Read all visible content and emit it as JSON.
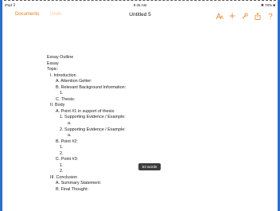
{
  "status_bar": {
    "carrier": "iPad ⊽",
    "time": "9:46 AM",
    "battery": "✱ 78% ■"
  },
  "toolbar": {
    "documents_label": "Documents",
    "undo_label": "Undo",
    "title": "Untitled 5",
    "accent_color": "#e8791c",
    "icons": [
      "text-format-icon",
      "add-icon",
      "wrench-icon",
      "share-icon",
      "help-icon"
    ]
  },
  "document": {
    "lines": [
      {
        "indent": 0,
        "text": "Essay Outline"
      },
      {
        "indent": 0,
        "text": "Essay"
      },
      {
        "indent": 0,
        "text": "Topic:"
      },
      {
        "indent": 1,
        "text": "I. Introduction"
      },
      {
        "indent": 2,
        "text": "A. Attention Getter:"
      },
      {
        "indent": 2,
        "text": "B. Relevant Background Information:"
      },
      {
        "indent": 3,
        "text": "1."
      },
      {
        "indent": 2,
        "text": "C. Thesis:"
      },
      {
        "indent": 1,
        "text": "II. Body"
      },
      {
        "indent": 2,
        "text": "A. Point #1 in support of thesis:"
      },
      {
        "indent": 3,
        "text": "1. Supporting Evidence / Example:"
      },
      {
        "indent": 4,
        "text": "a."
      },
      {
        "indent": 3,
        "text": "2. Supporting Evidence / Example:"
      },
      {
        "indent": 4,
        "text": "a."
      },
      {
        "indent": 2,
        "text": "B. Point #2:"
      },
      {
        "indent": 3,
        "text": "1."
      },
      {
        "indent": 3,
        "text": "2."
      },
      {
        "indent": 2,
        "text": "C. Point #3:"
      },
      {
        "indent": 3,
        "text": "1."
      },
      {
        "indent": 3,
        "text": "2."
      },
      {
        "indent": 1,
        "text": "III. Conclusion"
      },
      {
        "indent": 2,
        "text": "A. Summary Statement:"
      },
      {
        "indent": 2,
        "text": "B. Final Thought:"
      }
    ]
  },
  "word_count": {
    "label": "53 words"
  }
}
